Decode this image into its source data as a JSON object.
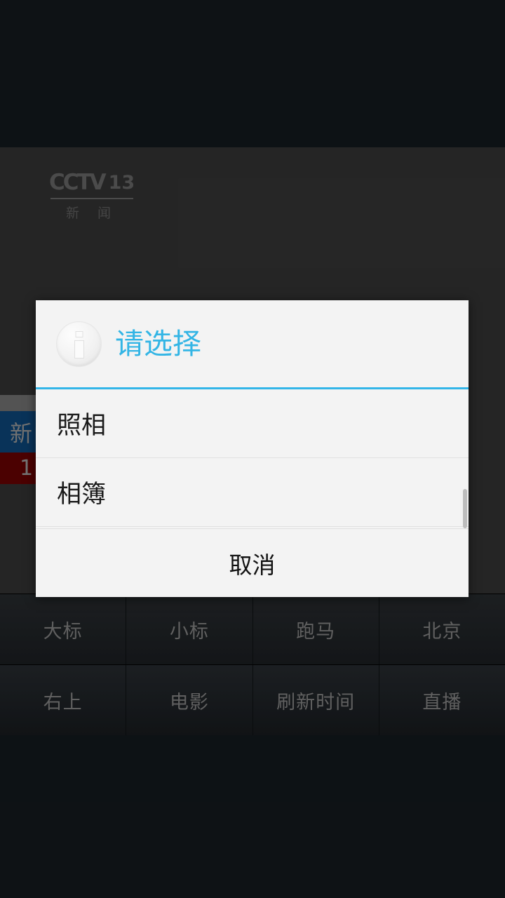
{
  "background": {
    "channel_logo": {
      "wordmark": "CCTV",
      "number": "13",
      "subtitle": "新 闻"
    },
    "banner_bands": [
      {
        "name": "gray-band",
        "text": ""
      },
      {
        "name": "blue-band",
        "text": "新闻"
      },
      {
        "name": "red-band",
        "text": "1"
      }
    ],
    "control_grid": {
      "rows": [
        {
          "buttons": [
            "大标",
            "小标",
            "跑马",
            "北京"
          ]
        },
        {
          "buttons": [
            "右上",
            "电影",
            "刷新时间",
            "直播"
          ]
        }
      ]
    }
  },
  "dialog": {
    "icon": "info-icon",
    "title": "请选择",
    "accent_color": "#33b5e5",
    "items": [
      {
        "label": "照相"
      },
      {
        "label": "相簿"
      }
    ],
    "cancel_label": "取消"
  }
}
